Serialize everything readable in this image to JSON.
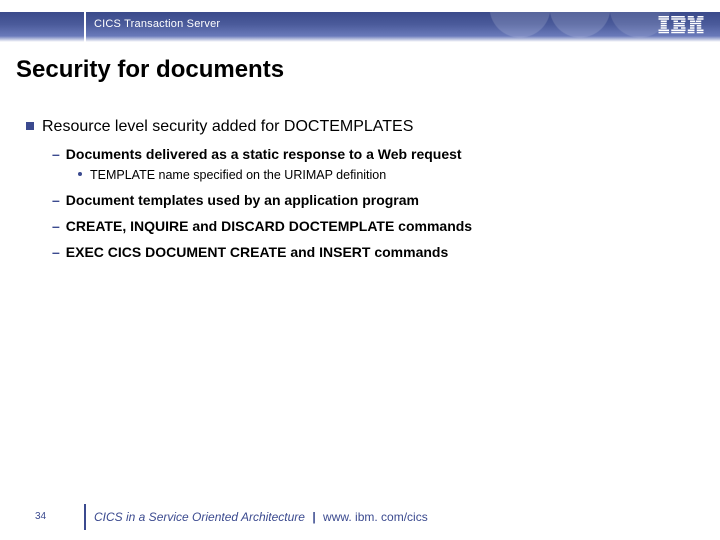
{
  "header": {
    "product": "CICS Transaction Server",
    "logo_label": "IBM"
  },
  "slide": {
    "title": "Security for documents"
  },
  "bullets": {
    "lvl1_0": "Resource level security added for DOCTEMPLATES",
    "lvl2_0": "Documents delivered as a static response to a Web request",
    "lvl3_0": "TEMPLATE name specified on the URIMAP definition",
    "lvl2_1": "Document templates used by an application program",
    "lvl2_2": "CREATE, INQUIRE and DISCARD DOCTEMPLATE commands",
    "lvl2_3": "EXEC CICS DOCUMENT CREATE and INSERT commands"
  },
  "footer": {
    "page": "34",
    "tagline": "CICS in a Service Oriented Architecture",
    "url": "www. ibm. com/cics"
  },
  "colors": {
    "accent": "#3b4a8f"
  }
}
